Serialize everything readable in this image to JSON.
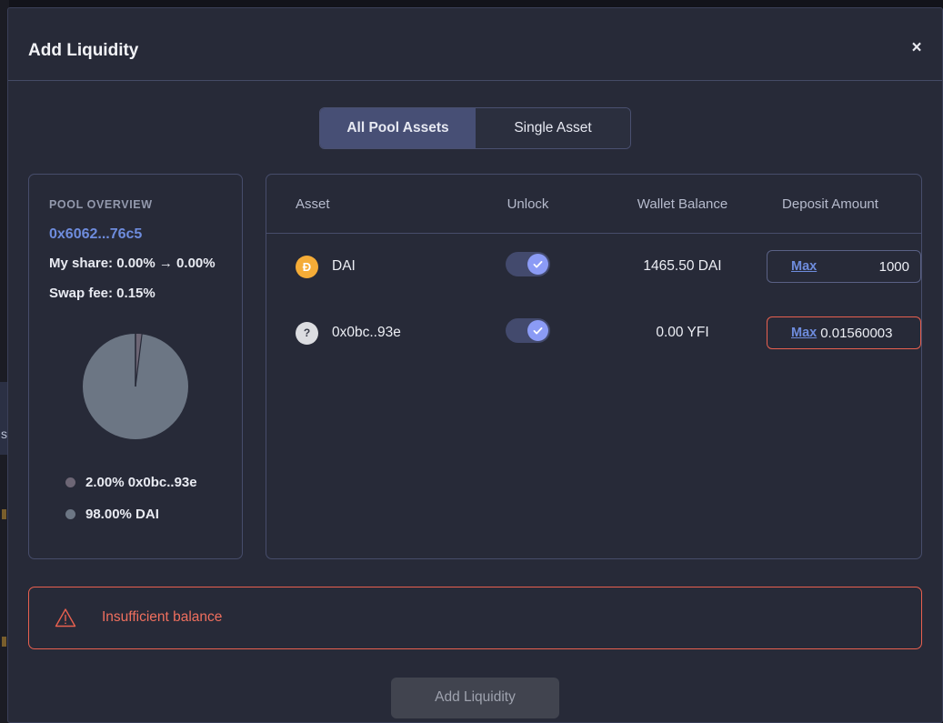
{
  "behind": {
    "text": "s"
  },
  "modal": {
    "title": "Add Liquidity",
    "close_icon": "×"
  },
  "tabs": [
    {
      "label": "All Pool Assets",
      "active": true
    },
    {
      "label": "Single Asset",
      "active": false
    }
  ],
  "pool_overview": {
    "heading": "POOL OVERVIEW",
    "address": "0x6062...76c5",
    "my_share": "My share: 0.00% → 0.00%",
    "swap_fee": "Swap fee: 0.15%"
  },
  "chart_data": {
    "type": "pie",
    "title": "Pool composition",
    "categories": [
      "0x0bc..93e",
      "DAI"
    ],
    "values": [
      2.0,
      98.0
    ],
    "labels": [
      "2.00% 0x0bc..93e",
      "98.00% DAI"
    ],
    "colors": [
      "#6d6675",
      "#6c7684"
    ],
    "legend_position": "bottom",
    "start_angle_deg": 0,
    "unit": "%"
  },
  "assets_table": {
    "headers": [
      "Asset",
      "Unlock",
      "Wallet Balance",
      "Deposit Amount"
    ],
    "rows": [
      {
        "icon_glyph": "Ð",
        "icon_kind": "dai",
        "asset": "DAI",
        "unlocked": true,
        "wallet_balance": "1465.50 DAI",
        "max_label": "Max",
        "deposit_amount": "1000",
        "error": false
      },
      {
        "icon_glyph": "?",
        "icon_kind": "unknown",
        "asset": "0x0bc..93e",
        "unlocked": true,
        "wallet_balance": "0.00 YFI",
        "max_label": "Max",
        "deposit_amount": "0.01560003",
        "error": true
      }
    ]
  },
  "error_banner": {
    "message": "Insufficient balance",
    "icon": "warning-triangle-icon"
  },
  "footer": {
    "submit_label": "Add Liquidity"
  },
  "colors": {
    "accent_blue": "#6e8cdd",
    "toggle_knob": "#8b9bf5",
    "error_red": "#e8604f",
    "dai_gold": "#f5ac37"
  }
}
